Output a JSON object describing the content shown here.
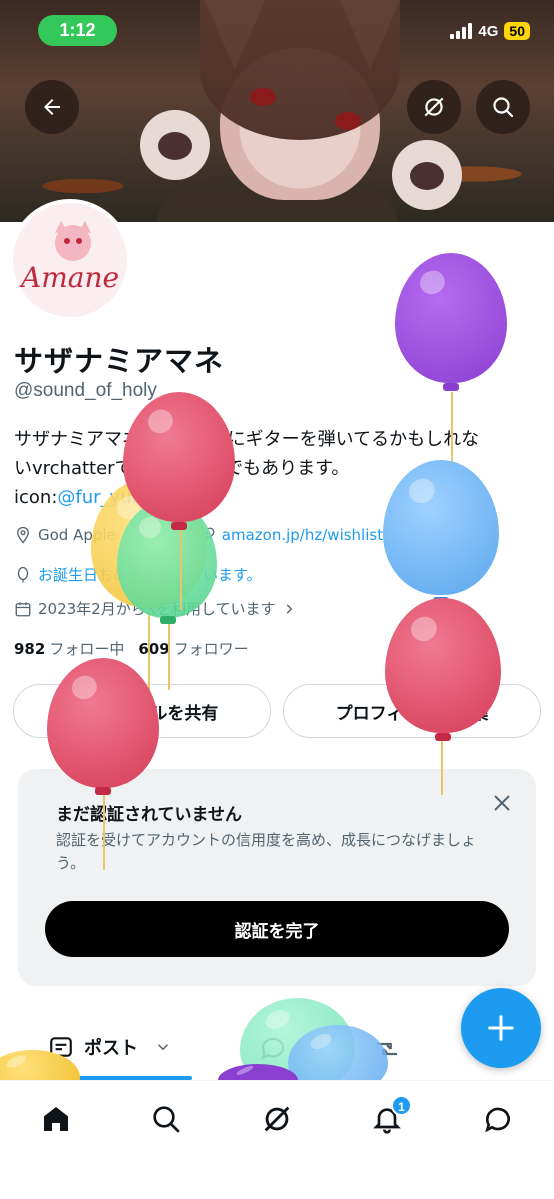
{
  "status_bar": {
    "time": "1:12",
    "network": "4G",
    "battery": "50"
  },
  "profile": {
    "name": "サザナミアマネ",
    "handle": "@sound_of_holy",
    "bio_line1": "サザナミアマネです。たまにギターを弾いてるかもしれな",
    "bio_line2": "いvrchatterです。 Enderでもあります。",
    "bio_icon_label": "icon:",
    "bio_icon_link": "@fur_yuli",
    "location": "God Apple",
    "website": "amazon.jp/hz/wishlist/ls...",
    "birthday": "お誕生日おめでとうございます。",
    "joined": "2023年2月からXを利用しています",
    "following_count": "982",
    "following_label": "フォロー中",
    "followers_count": "609",
    "followers_label": "フォロワー",
    "avatar_logo": "Amane"
  },
  "actions": {
    "share_profile": "プロフィールを共有",
    "edit_profile": "プロフィールを編集"
  },
  "verify_card": {
    "title": "まだ認証されていません",
    "description": "認証を受けてアカウントの信用度を高め、成長につなげましょう。",
    "button": "認証を完了"
  },
  "tabs": {
    "post": "ポスト"
  },
  "bottom_nav": {
    "notifications_badge": "1"
  },
  "colors": {
    "accent": "#1d9bf0",
    "status_green": "#34c759"
  }
}
